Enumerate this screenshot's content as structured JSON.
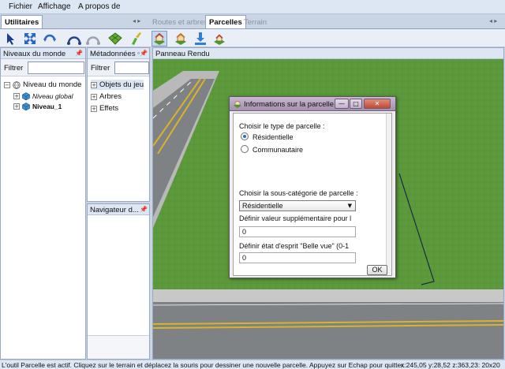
{
  "menu": {
    "items": [
      "Fichier",
      "Affichage",
      "A propos de"
    ]
  },
  "tabs": {
    "left": "Utilitaires",
    "right": [
      "Routes et arbres",
      "Parcelles",
      "Terrain"
    ],
    "arrows": "◂ ▸"
  },
  "icons": {
    "left_tools": [
      "select-arrow-icon",
      "move-icon",
      "rotate-icon",
      "road-curve-icon",
      "road-curve-disabled-icon",
      "grass-tile-icon",
      "paint-brush-icon"
    ],
    "right_tools": [
      "parcel-house-icon",
      "parcel-house-alt-icon",
      "download-arrow-icon",
      "parcel-house-small-icon"
    ]
  },
  "panels": {
    "world": {
      "title": "Niveaux du monde",
      "filter_label": "Filtrer",
      "tree": [
        {
          "label": "Niveau du monde",
          "style": "normal",
          "expander": "−"
        },
        {
          "label": "Niveau global",
          "style": "italic",
          "expander": "+"
        },
        {
          "label": "Niveau_1",
          "style": "bold",
          "expander": "+"
        }
      ]
    },
    "metadata": {
      "title": "Métadonnées",
      "filter_label": "Filtrer",
      "tree": [
        {
          "label": "Objets du jeu",
          "expander": "+"
        },
        {
          "label": "Arbres",
          "expander": "+"
        },
        {
          "label": "Effets",
          "expander": "+"
        }
      ]
    },
    "navigator": {
      "title": "Navigateur d..."
    },
    "render": {
      "title": "Panneau Rendu"
    }
  },
  "dialog": {
    "title": "Informations sur la parcelle",
    "parcel_type_label": "Choisir le type de parcelle :",
    "radio_options": [
      {
        "label": "Résidentielle",
        "checked": true
      },
      {
        "label": "Communautaire",
        "checked": false
      }
    ],
    "subcategory_label": "Choisir la sous-catégorie de parcelle :",
    "subcategory_value": "Résidentielle",
    "extra_value_label": "Définir valeur supplémentaire pour l",
    "extra_value": "0",
    "beautiful_view_label": "Définir état d'esprit \"Belle vue\" (0-1",
    "beautiful_view_value": "0",
    "ok_label": "OK",
    "window_buttons": {
      "minimize": "—",
      "maximize": "□",
      "close": "✕"
    }
  },
  "status": {
    "message": "L'outil Parcelle est actif. Cliquez sur le terrain et déplacez la souris pour dessiner une nouvelle parcelle. Appuyez sur Echap pour quitter.",
    "coords": "x:245,05 y:28,52 z:363,23: 20x20"
  },
  "colors": {
    "grass": "#5c9a3c",
    "asphalt": "#7f8285",
    "road_line": "#d9b32a",
    "dialog_title": "#a490ad",
    "selection_blue": "#2d6bc7"
  }
}
